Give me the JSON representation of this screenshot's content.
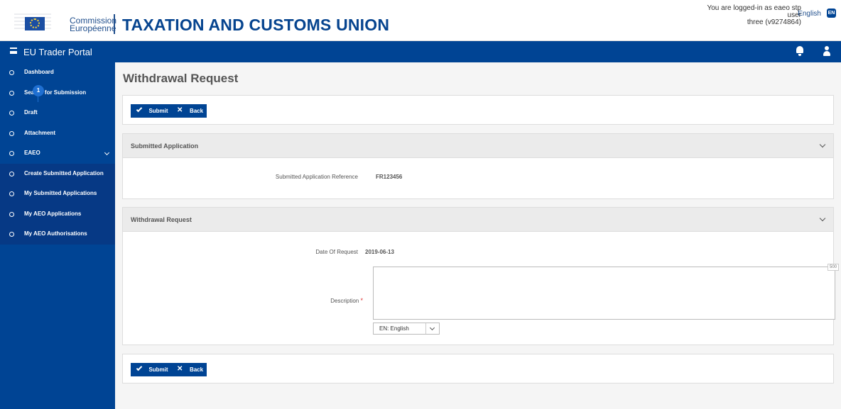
{
  "header": {
    "organization_line1": "Commission",
    "organization_line2": "Européenne",
    "title": "TAXATION AND CUSTOMS UNION",
    "user_line1": "You are logged-in as eaeo stp user",
    "user_line2": "three (v9274864)",
    "language": "English",
    "language_badge": "EN",
    "icons": [
      "european-commission-logo",
      "language-badge-icon"
    ]
  },
  "navbar": {
    "portal_name": "EU Trader Portal",
    "icons": [
      "menu-icon",
      "bell-icon",
      "user-icon"
    ]
  },
  "sidebar": {
    "items": [
      {
        "label": "Dashboard",
        "icon": "circle-icon"
      },
      {
        "label": "Search for Submission",
        "icon": "circle-icon"
      },
      {
        "label": "Draft",
        "icon": "circle-icon"
      },
      {
        "label": "Attachment",
        "icon": "circle-icon"
      },
      {
        "label": "EAEO",
        "icon": "circle-icon",
        "expand_icon": "chevron-down-icon"
      },
      {
        "label": "Create Submitted Application",
        "icon": "circle-icon"
      },
      {
        "label": "My Submitted Applications",
        "icon": "circle-icon"
      },
      {
        "label": "My AEO Applications",
        "icon": "circle-icon"
      },
      {
        "label": "My AEO Authorisations",
        "icon": "circle-icon"
      }
    ]
  },
  "page": {
    "title": "Withdrawal Request",
    "step_badge": "1",
    "submit_label": "Submit",
    "back_label": "Back",
    "icons": [
      "check-icon",
      "close-icon",
      "chevron-down-icon"
    ]
  },
  "submitted_application": {
    "title": "Submitted Application",
    "reference_label": "Submitted Application Reference",
    "reference_value": "FR123456"
  },
  "withdrawal_request": {
    "title": "Withdrawal Request",
    "date_label": "Date Of Request",
    "date_value": "2019-06-13",
    "description_label": "Description",
    "required_marker": "*",
    "description_value": "",
    "character_limit": "500",
    "language_selected": "EN: English"
  },
  "colors": {
    "primary": "#004494",
    "sidebar_submenu": "#063985",
    "title": "#06448f",
    "badge": "#1f6fd1",
    "section_header": "#ebebeb"
  }
}
